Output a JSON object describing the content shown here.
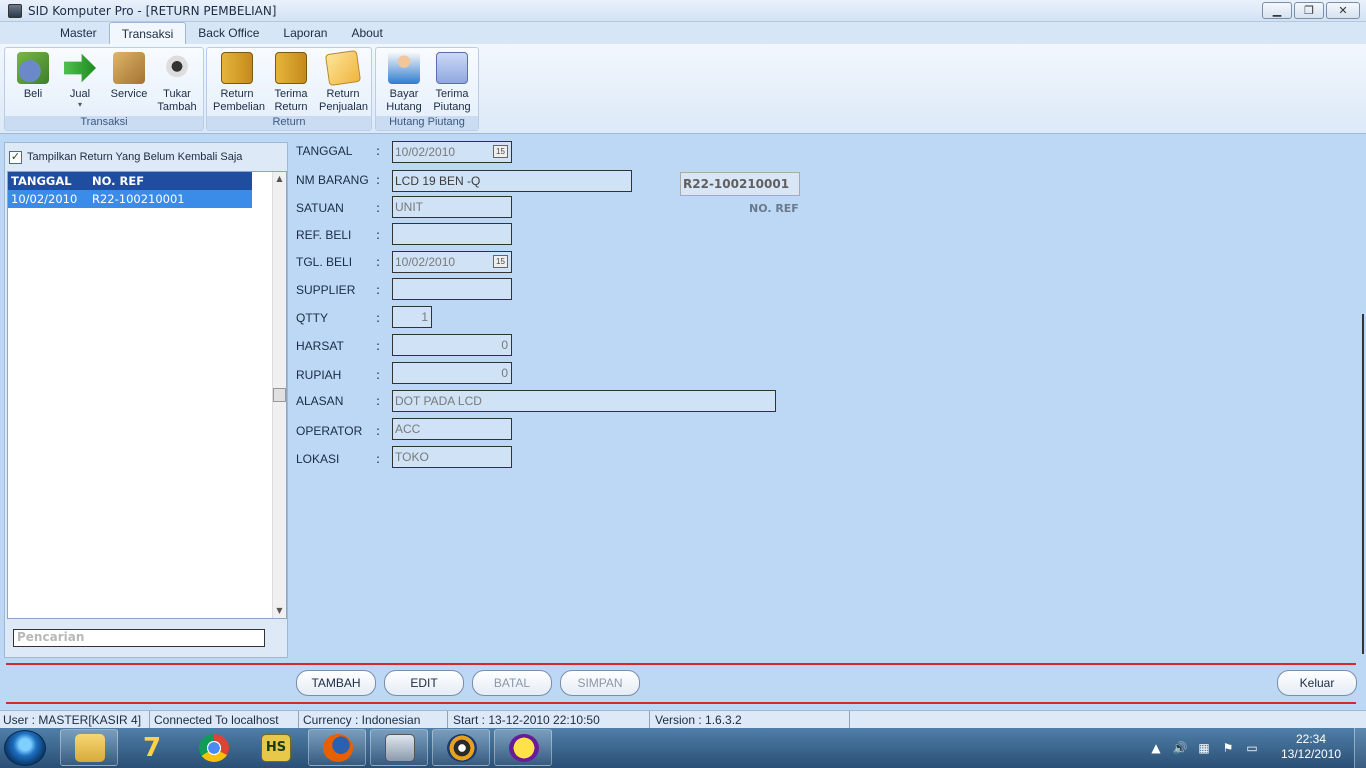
{
  "window": {
    "title": "SID Komputer Pro - [RETURN PEMBELIAN]",
    "minimize": "▁",
    "restore": "❐",
    "close": "✕"
  },
  "tabs": [
    "Master",
    "Transaksi",
    "Back Office",
    "Laporan",
    "About"
  ],
  "ribbon": {
    "groups": {
      "transaksi": "Transaksi",
      "return": "Return",
      "hutang": "Hutang Piutang"
    },
    "buttons": {
      "beli": "Beli",
      "jual": "Jual",
      "service": "Service",
      "tukar1": "Tukar",
      "tukar2": "Tambah",
      "rp1": "Return",
      "rp2": "Pembelian",
      "tr1": "Terima",
      "tr2": "Return",
      "rj1": "Return",
      "rj2": "Penjualan",
      "bh1": "Bayar",
      "bh2": "Hutang",
      "tp1": "Terima",
      "tp2": "Piutang"
    },
    "dropdown_arrow": "▾"
  },
  "left": {
    "checkbox_label": "Tampilkan Return Yang Belum Kembali Saja",
    "checkbox_mark": "✓",
    "grid": {
      "col_tanggal": "TANGGAL",
      "col_noref": "NO. REF",
      "row_tanggal": "10/02/2010",
      "row_noref": "R22-100210001"
    },
    "scroll_up": "▲",
    "scroll_down": "▼",
    "search_placeholder": "Pencarian"
  },
  "form": {
    "colon": ":",
    "cal_icon": "15",
    "tanggal_label": "TANGGAL",
    "tanggal": "10/02/2010",
    "nm_barang_label": "NM BARANG",
    "nm_barang": "LCD 19 BEN -Q",
    "satuan_label": "SATUAN",
    "satuan": "UNIT",
    "ref_beli_label": "REF. BELI",
    "ref_beli": "",
    "tgl_beli_label": "TGL. BELI",
    "tgl_beli": "10/02/2010",
    "supplier_label": "SUPPLIER",
    "supplier": "",
    "qtty_label": "QTTY",
    "qtty": "1",
    "harsat_label": "HARSAT",
    "harsat": "0",
    "rupiah_label": "RUPIAH",
    "rupiah": "0",
    "alasan_label": "ALASAN",
    "alasan": "DOT PADA LCD",
    "operator_label": "OPERATOR",
    "operator": "ACC",
    "lokasi_label": "LOKASI",
    "lokasi": "TOKO",
    "no_ref_value": "R22-100210001",
    "no_ref_label": "NO. REF"
  },
  "actions": {
    "tambah": "TAMBAH",
    "edit": "EDIT",
    "batal": "BATAL",
    "simpan": "SIMPAN",
    "keluar": "Keluar"
  },
  "status": {
    "user": "User : MASTER[KASIR 4]",
    "connection": "Connected To localhost",
    "currency": "Currency : Indonesian",
    "start": "Start  : 13-12-2010 22:10:50",
    "version": "Version : 1.6.3.2"
  },
  "taskbar": {
    "time": "22:34",
    "date": "13/12/2010",
    "tray_arrow": "▲",
    "tray_volume": "🔊",
    "tray_network": "▦",
    "tray_flag": "⚑",
    "tray_monitor": "▭",
    "hs_label": "HS",
    "seven_label": "7"
  }
}
